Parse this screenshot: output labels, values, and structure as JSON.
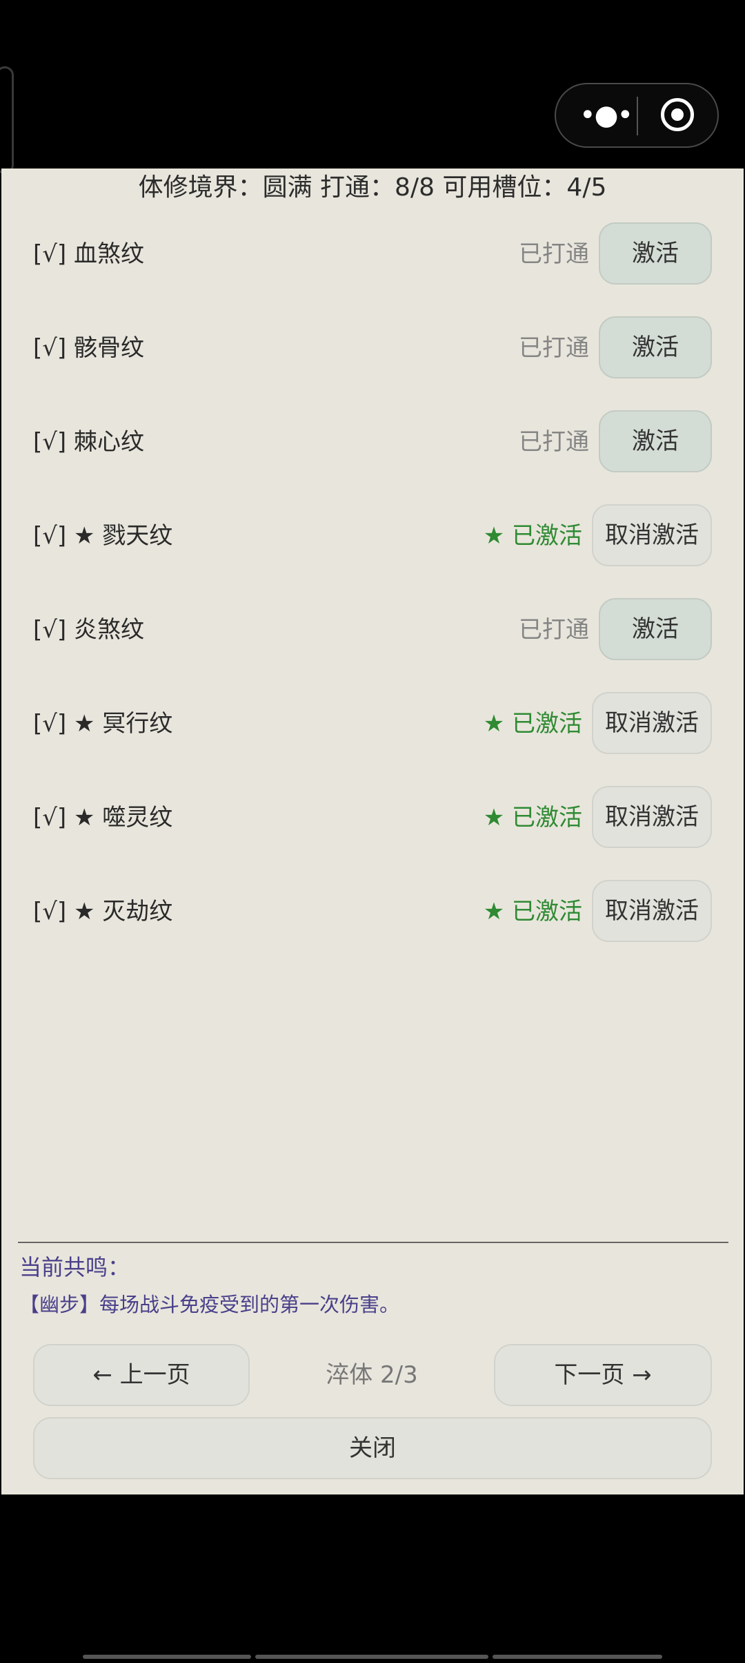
{
  "header": {
    "title": "体修境界：圆满  打通：8/8  可用槽位：4/5"
  },
  "glyph_list": [
    {
      "name": "[√] 血煞纹",
      "status": "已打通",
      "button": "激活",
      "state": "opened"
    },
    {
      "name": "[√] 骸骨纹",
      "status": "已打通",
      "button": "激活",
      "state": "opened"
    },
    {
      "name": "[√] 棘心纹",
      "status": "已打通",
      "button": "激活",
      "state": "opened"
    },
    {
      "name": "[√] ★ 戮天纹",
      "status": "★ 已激活",
      "button": "取消激活",
      "state": "active"
    },
    {
      "name": "[√] 炎煞纹",
      "status": "已打通",
      "button": "激活",
      "state": "opened"
    },
    {
      "name": "[√] ★ 冥行纹",
      "status": "★ 已激活",
      "button": "取消激活",
      "state": "active"
    },
    {
      "name": "[√] ★ 噬灵纹",
      "status": "★ 已激活",
      "button": "取消激活",
      "state": "active"
    },
    {
      "name": "[√] ★ 灭劫纹",
      "status": "★ 已激活",
      "button": "取消激活",
      "state": "active"
    }
  ],
  "resonance": {
    "title": "当前共鸣：",
    "desc": "【幽步】每场战斗免疫受到的第一次伤害。"
  },
  "pager": {
    "prev": "← 上一页",
    "indicator": "淬体 2/3",
    "next": "下一页 →"
  },
  "close_label": "关闭",
  "capsule": {
    "more_icon": "•●•"
  },
  "colors": {
    "panel_bg": "#e8e6dc",
    "active_green": "#2f8a33",
    "resonance_purple": "#4a3f8a"
  }
}
